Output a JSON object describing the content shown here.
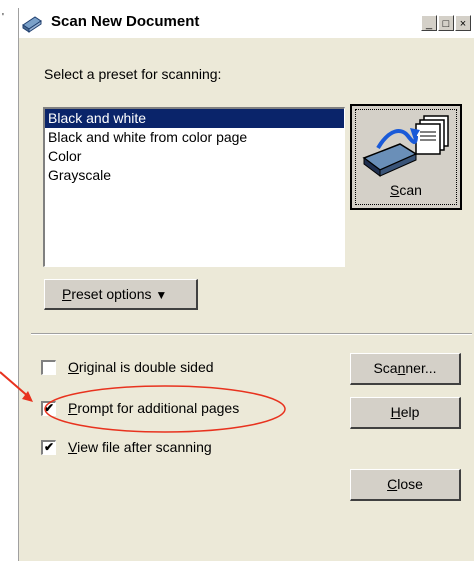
{
  "window": {
    "title": "Scan New Document",
    "minimize_glyph": "_",
    "maximize_glyph": "□",
    "close_glyph": "×"
  },
  "preset_prompt": "Select a preset for scanning:",
  "preset_list": {
    "items": [
      {
        "label": "Black and white",
        "selected": true
      },
      {
        "label": "Black and white from color page",
        "selected": false
      },
      {
        "label": "Color",
        "selected": false
      },
      {
        "label": "Grayscale",
        "selected": false
      }
    ]
  },
  "scan_button": {
    "label_prefix": "",
    "label_mnemonic": "S",
    "label_rest": "can",
    "icon": "scanner-icon"
  },
  "preset_options": {
    "label_prefix": "",
    "label_mnemonic": "P",
    "label_rest": "reset options",
    "dropdown_glyph": "▼"
  },
  "options": {
    "double_sided": {
      "mnemonic": "O",
      "rest": "riginal is double sided",
      "checked": false
    },
    "prompt_pages": {
      "mnemonic": "P",
      "rest": "rompt for additional pages",
      "checked": true
    },
    "view_file": {
      "mnemonic": "V",
      "rest": "iew file after scanning",
      "checked": true
    }
  },
  "buttons": {
    "scanner": {
      "prefix": "Sca",
      "mnemonic": "n",
      "rest": "ner..."
    },
    "help": {
      "prefix": "",
      "mnemonic": "H",
      "rest": "elp"
    },
    "close": {
      "prefix": "",
      "mnemonic": "C",
      "rest": "lose"
    }
  },
  "check_glyph": "✔",
  "colors": {
    "dialog_bg": "#ece9d8",
    "selection": "#0a246a",
    "annotation": "#e8321e"
  }
}
